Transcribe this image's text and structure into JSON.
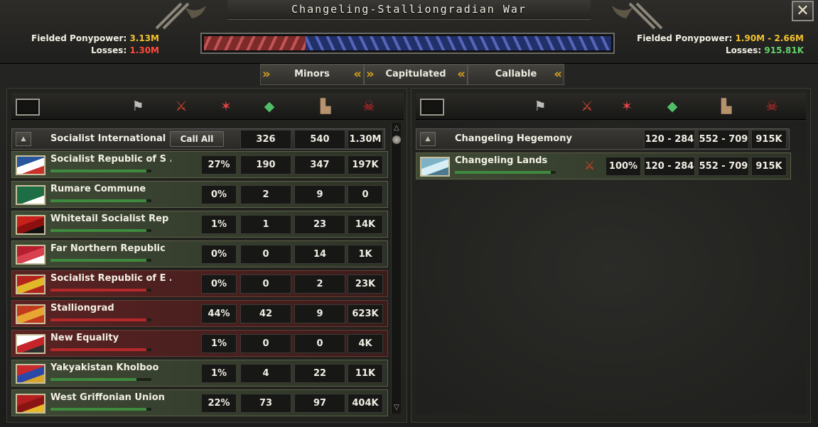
{
  "window": {
    "title": "Changeling-Stalliongradian War",
    "close_label": "✕"
  },
  "attacker": {
    "fielded_label": "Fielded Ponypower:",
    "fielded_value": "3.13M",
    "losses_label": "Losses:",
    "losses_value": "1.30M"
  },
  "defender": {
    "fielded_label": "Fielded Ponypower:",
    "fielded_value": "1.90M - 2.66M",
    "losses_label": "Losses:",
    "losses_value": "915.81K"
  },
  "war_balance": {
    "attacker_share": 0.25
  },
  "tabs": [
    {
      "label": "Minors"
    },
    {
      "label": "Capitulated"
    },
    {
      "label": "Callable"
    }
  ],
  "columns_icons": [
    "flag-icon",
    "crossed-swords-icon",
    "casualties-icon",
    "surrender-icon",
    "factory-icon",
    "skull-icon"
  ],
  "left": {
    "leader": {
      "name": "Socialist International",
      "call_all": "Call All",
      "c1": "326",
      "c2": "540",
      "c3": "1.30M"
    },
    "rows": [
      {
        "name": "Socialist Republic of S ...",
        "pct": "27%",
        "c1": "190",
        "c2": "347",
        "c3": "197K",
        "style": "green",
        "bar": 0.95,
        "barColor": "#3e8a3e",
        "flag": [
          "#2a56a0",
          "#ffffff",
          "#c9302c"
        ]
      },
      {
        "name": "Rumare Commune",
        "pct": "0%",
        "c1": "2",
        "c2": "9",
        "c3": "0",
        "style": "green",
        "bar": 0.95,
        "barColor": "#3e8a3e",
        "flag": [
          "#1e6e45",
          "#1e6e45",
          "#ffffff"
        ]
      },
      {
        "name": "Whitetail Socialist Rep ...",
        "pct": "1%",
        "c1": "1",
        "c2": "23",
        "c3": "14K",
        "style": "green",
        "bar": 0.95,
        "barColor": "#3e8a3e",
        "flag": [
          "#c8211b",
          "#8c1010",
          "#111111"
        ]
      },
      {
        "name": "Far Northern Republic",
        "pct": "0%",
        "c1": "0",
        "c2": "14",
        "c3": "1K",
        "style": "green",
        "bar": 0.95,
        "barColor": "#3e8a3e",
        "flag": [
          "#b51e2e",
          "#d94050",
          "#ffffff"
        ]
      },
      {
        "name": "Socialist Republic of E ...",
        "pct": "0%",
        "c1": "0",
        "c2": "2",
        "c3": "23K",
        "style": "redrow",
        "bar": 0.95,
        "barColor": "#b7282a",
        "flag": [
          "#b5231d",
          "#e0b82a",
          "#b5231d"
        ]
      },
      {
        "name": "Stalliongrad",
        "pct": "44%",
        "c1": "42",
        "c2": "9",
        "c3": "623K",
        "style": "redrow",
        "bar": 0.95,
        "barColor": "#b7282a",
        "flag": [
          "#c23a1d",
          "#e7a634",
          "#c23a1d"
        ]
      },
      {
        "name": "New Equality",
        "pct": "1%",
        "c1": "0",
        "c2": "0",
        "c3": "4K",
        "style": "redrow",
        "bar": 0.95,
        "barColor": "#b7282a",
        "flag": [
          "#ffffff",
          "#c4242a",
          "#2e2e2e"
        ]
      },
      {
        "name": "Yakyakistan Kholboo",
        "pct": "1%",
        "c1": "4",
        "c2": "22",
        "c3": "11K",
        "style": "green",
        "bar": 0.85,
        "barColor": "#3e8a3e",
        "flag": [
          "#c8292d",
          "#2948a8",
          "#d9a62a"
        ]
      },
      {
        "name": "West Griffonian Union",
        "pct": "22%",
        "c1": "73",
        "c2": "97",
        "c3": "404K",
        "style": "green",
        "bar": 0.95,
        "barColor": "#3e8a3e",
        "flag": [
          "#b51f1f",
          "#8a1414",
          "#e6b92b"
        ]
      }
    ]
  },
  "right": {
    "leader": {
      "name": "Changeling Hegemony",
      "c1": "120 - 284",
      "c2": "552 - 709",
      "c3": "915K"
    },
    "rows": [
      {
        "name": "Changeling Lands",
        "pct": "100%",
        "c1": "120 - 284",
        "c2": "552 - 709",
        "c3": "915K",
        "style": "green",
        "bar": 0.95,
        "barColor": "#3e8a3e",
        "flag": [
          "#7fb2c7",
          "#d7eef5",
          "#4b7a90"
        ]
      }
    ]
  }
}
